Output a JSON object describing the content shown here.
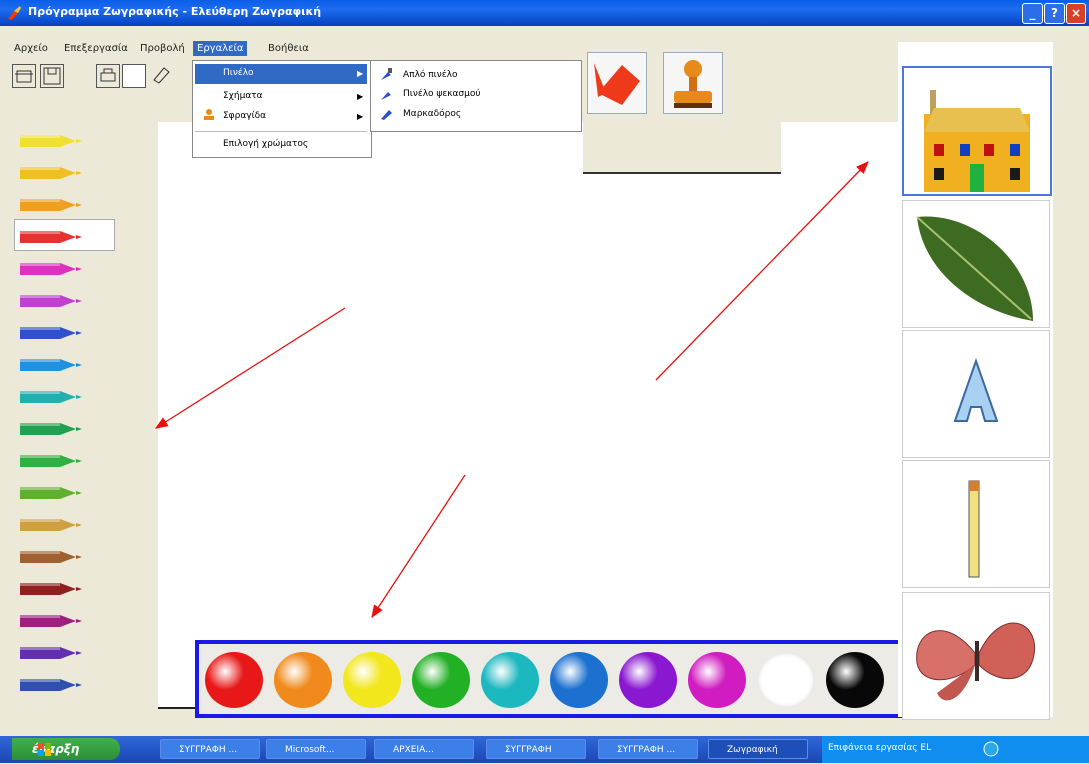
{
  "window": {
    "title": "Πρόγραμμα Ζωγραφικής - Ελεύθερη Ζωγραφική"
  },
  "menubar": {
    "items": [
      "Αρχείο",
      "Επεξεργασία",
      "Προβολή",
      "Εργαλεία",
      "Βοήθεια"
    ]
  },
  "tools_menu": {
    "items": [
      "Πινέλο",
      "Σχήματα",
      "Σφραγίδα",
      "Επιλογή χρώματος"
    ]
  },
  "brush_submenu": {
    "items": [
      "Απλό πινέλο",
      "Πινέλο ψεκασμού",
      "Μαρκαδόρος"
    ]
  },
  "crayons": {
    "colors": [
      "#f0e030",
      "#f0c020",
      "#f0a020",
      "#e83030",
      "#e030c0",
      "#c040d0",
      "#3050d0",
      "#2090e0",
      "#20b0b0",
      "#20a050",
      "#30b040",
      "#60b030",
      "#d0a040",
      "#a06030",
      "#902020",
      "#a02080",
      "#6030b0",
      "#3050b0"
    ]
  },
  "palette": {
    "colors": [
      "#e81818",
      "#f08a1c",
      "#f2e61c",
      "#22b024",
      "#1cb8c0",
      "#1c70d0",
      "#8a18d0",
      "#d01cc0",
      "#ffffff",
      "#080808"
    ]
  },
  "stamps": {
    "items": [
      "house-icon",
      "leaf-icon",
      "letter-a-icon",
      "pencil-icon",
      "butterfly-icon"
    ]
  },
  "taskbar": {
    "start_label": "έναρξη",
    "tasks": [
      "ΣΥΓΓΡΑΦΗ ...",
      "Microsoft...",
      "ΑΡΧΕΙΑ...",
      "ΣΥΓΓΡΑΦΗ",
      "ΣΥΓΓΡΑΦΗ ...",
      "Ζωγραφική"
    ],
    "tray": "Επιφάνεια εργασίας  EL"
  },
  "accent_color": "#e81010"
}
